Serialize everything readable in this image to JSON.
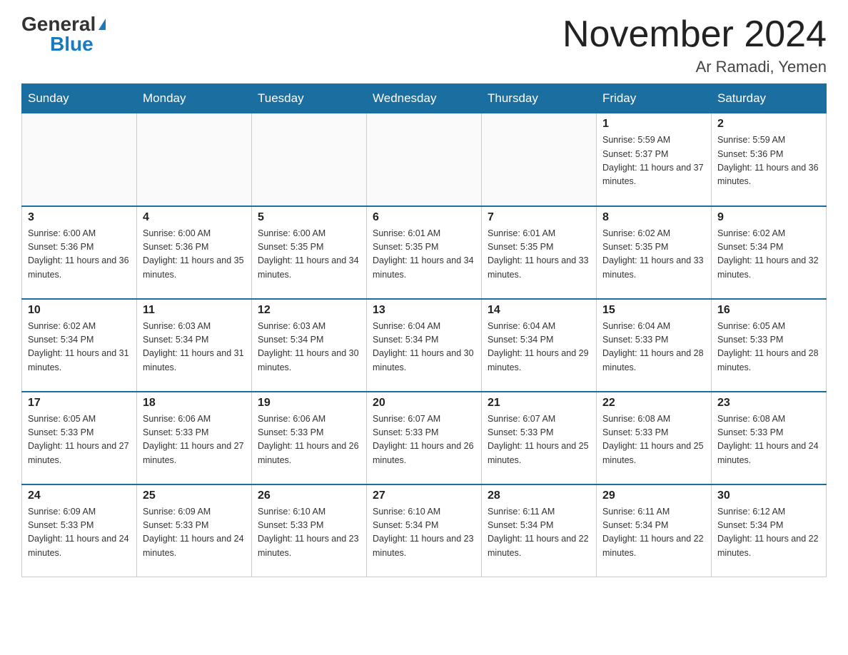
{
  "logo": {
    "general": "General",
    "blue": "Blue"
  },
  "title": "November 2024",
  "location": "Ar Ramadi, Yemen",
  "days_of_week": [
    "Sunday",
    "Monday",
    "Tuesday",
    "Wednesday",
    "Thursday",
    "Friday",
    "Saturday"
  ],
  "weeks": [
    [
      {
        "day": "",
        "info": ""
      },
      {
        "day": "",
        "info": ""
      },
      {
        "day": "",
        "info": ""
      },
      {
        "day": "",
        "info": ""
      },
      {
        "day": "",
        "info": ""
      },
      {
        "day": "1",
        "info": "Sunrise: 5:59 AM\nSunset: 5:37 PM\nDaylight: 11 hours and 37 minutes."
      },
      {
        "day": "2",
        "info": "Sunrise: 5:59 AM\nSunset: 5:36 PM\nDaylight: 11 hours and 36 minutes."
      }
    ],
    [
      {
        "day": "3",
        "info": "Sunrise: 6:00 AM\nSunset: 5:36 PM\nDaylight: 11 hours and 36 minutes."
      },
      {
        "day": "4",
        "info": "Sunrise: 6:00 AM\nSunset: 5:36 PM\nDaylight: 11 hours and 35 minutes."
      },
      {
        "day": "5",
        "info": "Sunrise: 6:00 AM\nSunset: 5:35 PM\nDaylight: 11 hours and 34 minutes."
      },
      {
        "day": "6",
        "info": "Sunrise: 6:01 AM\nSunset: 5:35 PM\nDaylight: 11 hours and 34 minutes."
      },
      {
        "day": "7",
        "info": "Sunrise: 6:01 AM\nSunset: 5:35 PM\nDaylight: 11 hours and 33 minutes."
      },
      {
        "day": "8",
        "info": "Sunrise: 6:02 AM\nSunset: 5:35 PM\nDaylight: 11 hours and 33 minutes."
      },
      {
        "day": "9",
        "info": "Sunrise: 6:02 AM\nSunset: 5:34 PM\nDaylight: 11 hours and 32 minutes."
      }
    ],
    [
      {
        "day": "10",
        "info": "Sunrise: 6:02 AM\nSunset: 5:34 PM\nDaylight: 11 hours and 31 minutes."
      },
      {
        "day": "11",
        "info": "Sunrise: 6:03 AM\nSunset: 5:34 PM\nDaylight: 11 hours and 31 minutes."
      },
      {
        "day": "12",
        "info": "Sunrise: 6:03 AM\nSunset: 5:34 PM\nDaylight: 11 hours and 30 minutes."
      },
      {
        "day": "13",
        "info": "Sunrise: 6:04 AM\nSunset: 5:34 PM\nDaylight: 11 hours and 30 minutes."
      },
      {
        "day": "14",
        "info": "Sunrise: 6:04 AM\nSunset: 5:34 PM\nDaylight: 11 hours and 29 minutes."
      },
      {
        "day": "15",
        "info": "Sunrise: 6:04 AM\nSunset: 5:33 PM\nDaylight: 11 hours and 28 minutes."
      },
      {
        "day": "16",
        "info": "Sunrise: 6:05 AM\nSunset: 5:33 PM\nDaylight: 11 hours and 28 minutes."
      }
    ],
    [
      {
        "day": "17",
        "info": "Sunrise: 6:05 AM\nSunset: 5:33 PM\nDaylight: 11 hours and 27 minutes."
      },
      {
        "day": "18",
        "info": "Sunrise: 6:06 AM\nSunset: 5:33 PM\nDaylight: 11 hours and 27 minutes."
      },
      {
        "day": "19",
        "info": "Sunrise: 6:06 AM\nSunset: 5:33 PM\nDaylight: 11 hours and 26 minutes."
      },
      {
        "day": "20",
        "info": "Sunrise: 6:07 AM\nSunset: 5:33 PM\nDaylight: 11 hours and 26 minutes."
      },
      {
        "day": "21",
        "info": "Sunrise: 6:07 AM\nSunset: 5:33 PM\nDaylight: 11 hours and 25 minutes."
      },
      {
        "day": "22",
        "info": "Sunrise: 6:08 AM\nSunset: 5:33 PM\nDaylight: 11 hours and 25 minutes."
      },
      {
        "day": "23",
        "info": "Sunrise: 6:08 AM\nSunset: 5:33 PM\nDaylight: 11 hours and 24 minutes."
      }
    ],
    [
      {
        "day": "24",
        "info": "Sunrise: 6:09 AM\nSunset: 5:33 PM\nDaylight: 11 hours and 24 minutes."
      },
      {
        "day": "25",
        "info": "Sunrise: 6:09 AM\nSunset: 5:33 PM\nDaylight: 11 hours and 24 minutes."
      },
      {
        "day": "26",
        "info": "Sunrise: 6:10 AM\nSunset: 5:33 PM\nDaylight: 11 hours and 23 minutes."
      },
      {
        "day": "27",
        "info": "Sunrise: 6:10 AM\nSunset: 5:34 PM\nDaylight: 11 hours and 23 minutes."
      },
      {
        "day": "28",
        "info": "Sunrise: 6:11 AM\nSunset: 5:34 PM\nDaylight: 11 hours and 22 minutes."
      },
      {
        "day": "29",
        "info": "Sunrise: 6:11 AM\nSunset: 5:34 PM\nDaylight: 11 hours and 22 minutes."
      },
      {
        "day": "30",
        "info": "Sunrise: 6:12 AM\nSunset: 5:34 PM\nDaylight: 11 hours and 22 minutes."
      }
    ]
  ]
}
